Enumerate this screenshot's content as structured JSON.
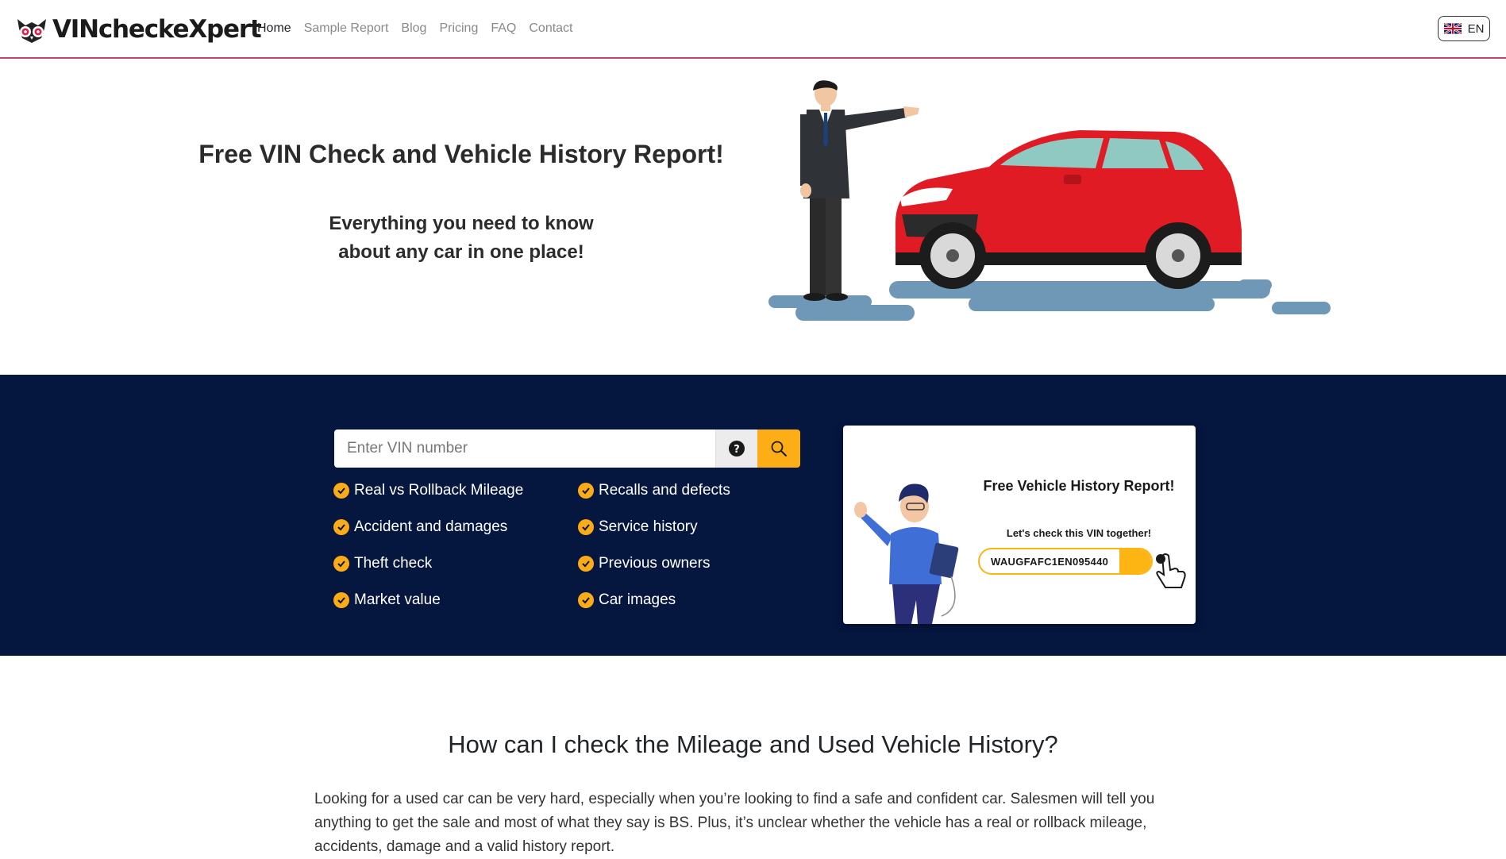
{
  "header": {
    "brand": "VINcheckeXpert",
    "nav": [
      {
        "label": "Home",
        "active": true
      },
      {
        "label": "Sample Report",
        "active": false
      },
      {
        "label": "Blog",
        "active": false
      },
      {
        "label": "Pricing",
        "active": false
      },
      {
        "label": "FAQ",
        "active": false
      },
      {
        "label": "Contact",
        "active": false
      }
    ],
    "language": "EN",
    "language_icon": "uk-flag-icon"
  },
  "hero": {
    "title": "Free VIN Check and Vehicle History Report!",
    "subtitle_line1": "Everything you need to know",
    "subtitle_line2": "about any car in one place!"
  },
  "search": {
    "placeholder": "Enter VIN number",
    "value": "",
    "help_icon": "question-circle-icon",
    "search_icon": "magnifier-icon",
    "accent_color": "#fdad16"
  },
  "features": [
    "Real vs Rollback Mileage",
    "Recalls and defects",
    "Accident and damages",
    "Service history",
    "Theft check",
    "Previous owners",
    "Market value",
    "Car images"
  ],
  "promo": {
    "title": "Free Vehicle History Report!",
    "subtitle": "Let's check this VIN together!",
    "vin": "WAUGFAFC1EN095440"
  },
  "content": {
    "title": "How can I check the Mileage and Used Vehicle History?",
    "body": "Looking for a used car can be very hard, especially when you’re looking to find a safe and confident car. Salesmen will tell you anything to get the sale and most of what they say is BS. Plus, it’s unclear whether the vehicle has a real or rollback mileage, accidents, damage and a valid history report."
  },
  "colors": {
    "navbar_border": "#c2436b",
    "band_background": "#05163f",
    "check_color": "#fbab18",
    "car_red": "#e01b24",
    "puddle": "#6f97b6"
  }
}
